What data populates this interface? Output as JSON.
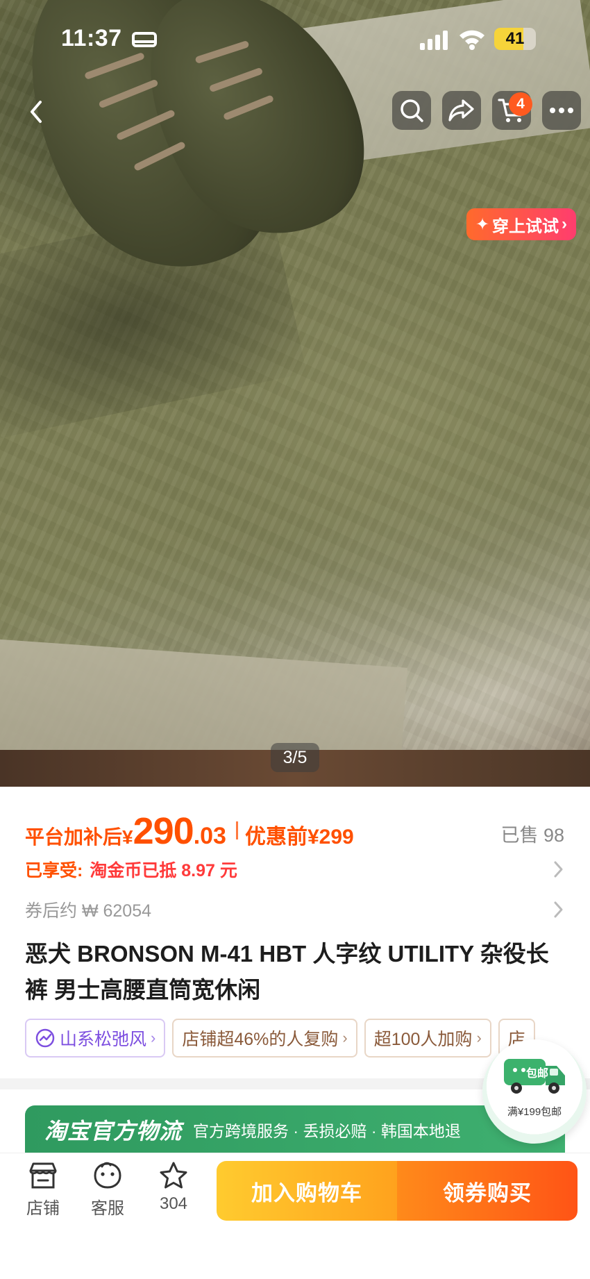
{
  "status_bar": {
    "time": "11:37",
    "battery": "41"
  },
  "nav": {
    "cart_count": "4"
  },
  "hero": {
    "try_on_label": "穿上试试",
    "pager": "3/5"
  },
  "price": {
    "prefix": "平台加补后¥",
    "integer": "290",
    "decimal": ".03",
    "before_label": "优惠前¥299",
    "sold": "已售 98"
  },
  "discount": {
    "label": "已享受:",
    "value": "淘金币已抵 8.97 元"
  },
  "coupon": {
    "text": "券后约 ₩ 62054"
  },
  "product": {
    "title": "恶犬 BRONSON M-41 HBT 人字纹 UTILITY 杂役长裤 男士高腰直筒宽休闲"
  },
  "tags": [
    {
      "label": "山系松弛风"
    },
    {
      "label": "店铺超46%的人复购"
    },
    {
      "label": "超100人加购"
    },
    {
      "label": "店"
    }
  ],
  "logistics": {
    "brand": "淘宝官方物流",
    "desc": "官方跨境服务 · 丢损必赔 · 韩国本地退"
  },
  "free_shipping": {
    "badge": "包邮",
    "note": "满¥199包邮"
  },
  "bottom_bar": {
    "shop_label": "店铺",
    "service_label": "客服",
    "favorite_count": "304",
    "add_to_cart": "加入购物车",
    "buy_now": "领券购买"
  },
  "colors": {
    "price_orange": "#ff5000",
    "cta_yellow": "#ffb020",
    "cta_orange": "#ff5416",
    "logistics_green": "#35a466"
  }
}
